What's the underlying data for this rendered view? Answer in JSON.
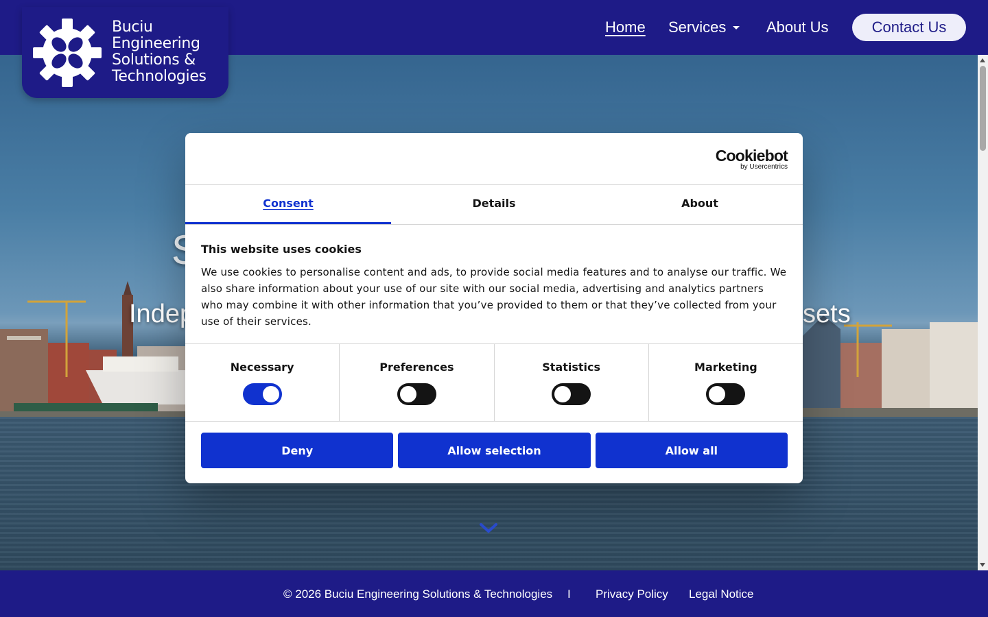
{
  "header": {
    "logo_lines": [
      "Buciu",
      "Engineering",
      "Solutions &",
      "Technologies"
    ],
    "nav": {
      "home": "Home",
      "services": "Services",
      "about": "About Us"
    },
    "contact_label": "Contact Us"
  },
  "hero": {
    "title_fragment": "S",
    "subtitle_left": "Indep",
    "subtitle_right": "sets"
  },
  "cookie_dialog": {
    "brand": "Cookiebot",
    "brand_sub": "by Usercentrics",
    "tabs": [
      "Consent",
      "Details",
      "About"
    ],
    "active_tab": "Consent",
    "heading": "This website uses cookies",
    "body": "We use cookies to personalise content and ads, to provide social media features and to analyse our traffic. We also share information about your use of our site with our social media, advertising and analytics partners who may combine it with other information that you’ve provided to them or that they’ve collected from your use of their services.",
    "categories": [
      {
        "label": "Necessary",
        "checked": true
      },
      {
        "label": "Preferences",
        "checked": false
      },
      {
        "label": "Statistics",
        "checked": false
      },
      {
        "label": "Marketing",
        "checked": false
      }
    ],
    "buttons": {
      "deny": "Deny",
      "allow_selection": "Allow selection",
      "allow_all": "Allow all"
    },
    "accent_color": "#1032cf"
  },
  "footer": {
    "copyright": "© 2026 Buciu Engineering Solutions & Technologies",
    "separator": "I",
    "privacy": "Privacy Policy",
    "legal": "Legal Notice"
  },
  "colors": {
    "brand": "#1e1b87",
    "button_blue": "#1032cf"
  },
  "icons": {
    "logo": "gear-icon",
    "scroll": "chevron-down-icon",
    "services_dropdown": "caret-down-icon"
  }
}
